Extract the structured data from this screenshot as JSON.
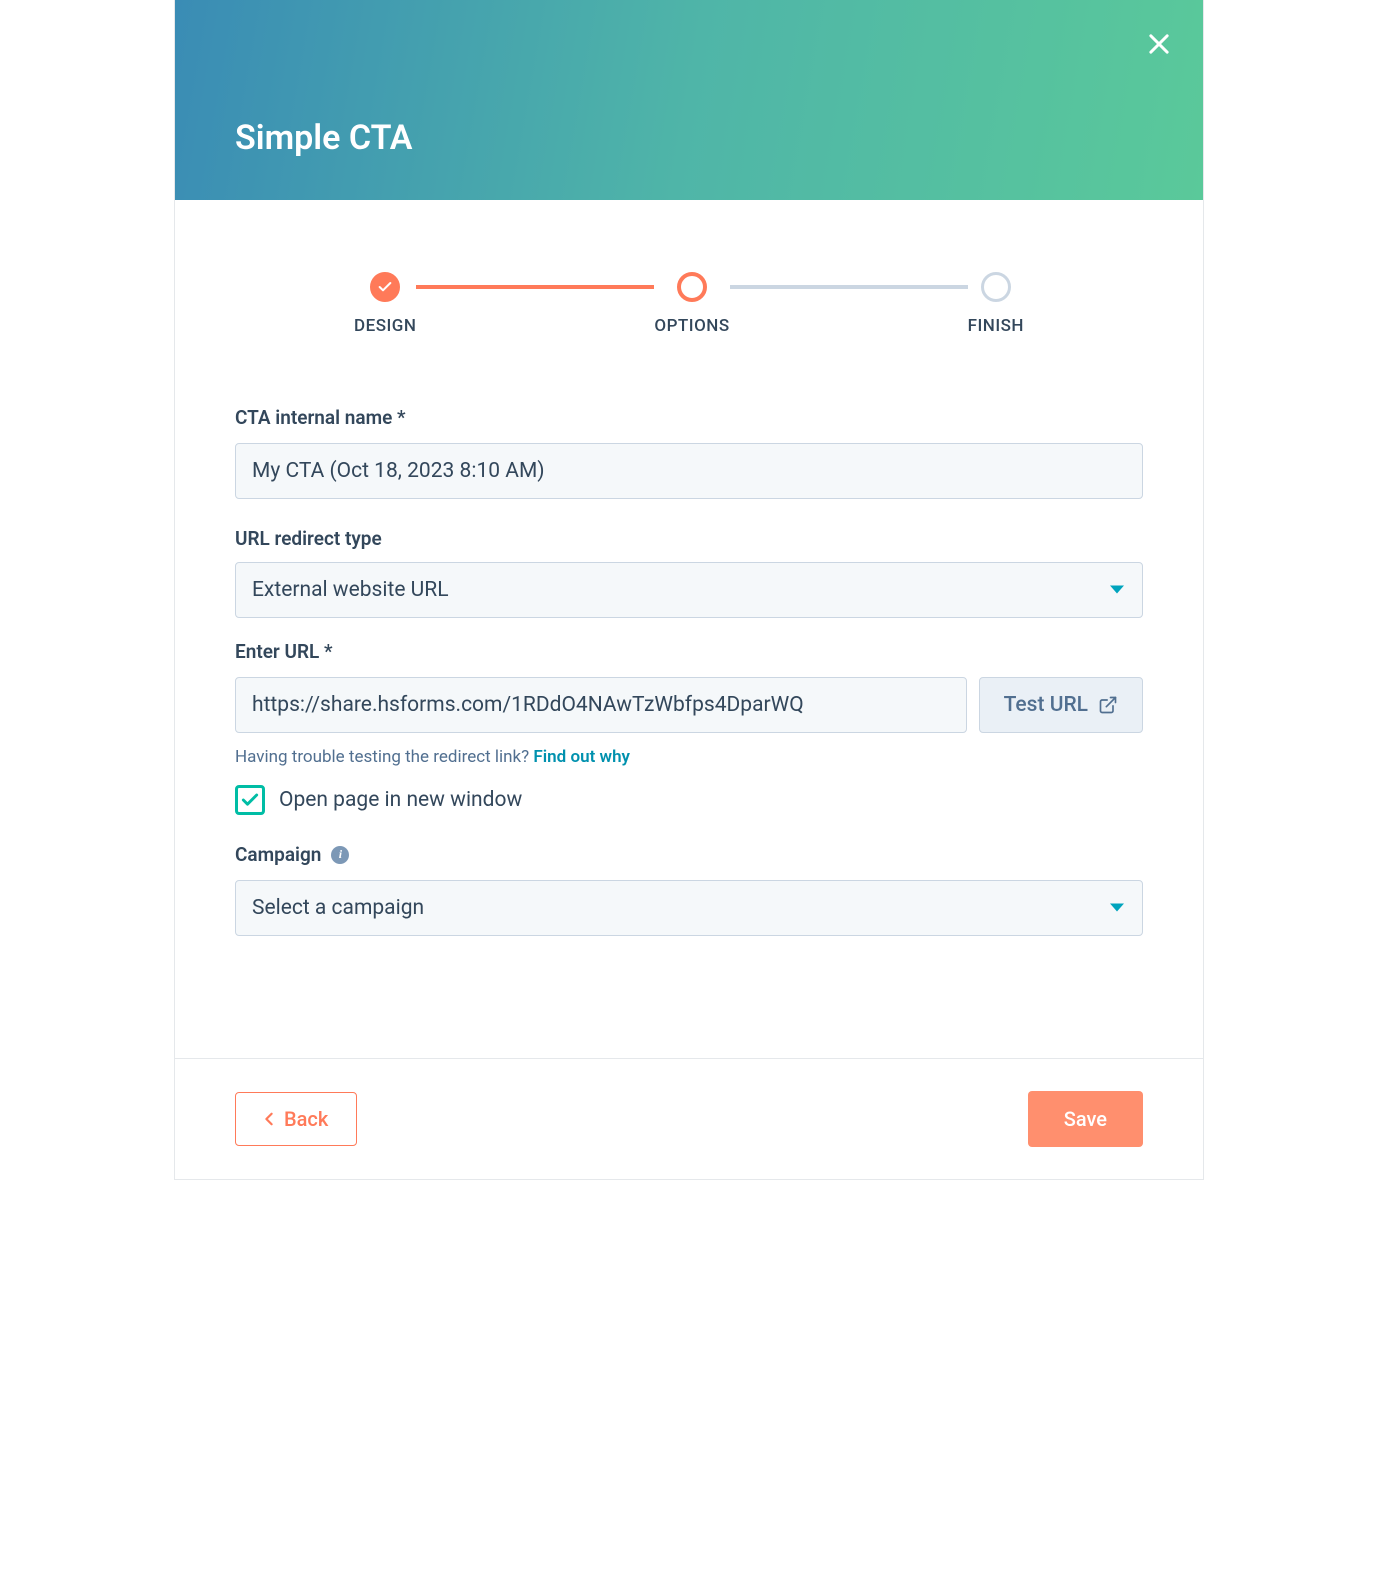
{
  "header": {
    "title": "Simple CTA"
  },
  "stepper": {
    "steps": [
      {
        "label": "DESIGN",
        "state": "completed"
      },
      {
        "label": "OPTIONS",
        "state": "active"
      },
      {
        "label": "FINISH",
        "state": "inactive"
      }
    ]
  },
  "form": {
    "cta_name": {
      "label": "CTA internal name *",
      "value": "My CTA (Oct 18, 2023 8:10 AM)"
    },
    "url_type": {
      "label": "URL redirect type",
      "value": "External website URL"
    },
    "enter_url": {
      "label": "Enter URL *",
      "value": "https://share.hsforms.com/1RDdO4NAwTzWbfps4DparWQ",
      "test_label": "Test URL",
      "help_text": "Having trouble testing the redirect link? ",
      "help_link": "Find out why"
    },
    "open_new_window": {
      "label": "Open page in new window",
      "checked": true
    },
    "campaign": {
      "label": "Campaign",
      "placeholder": "Select a campaign"
    }
  },
  "footer": {
    "back_label": "Back",
    "save_label": "Save"
  }
}
